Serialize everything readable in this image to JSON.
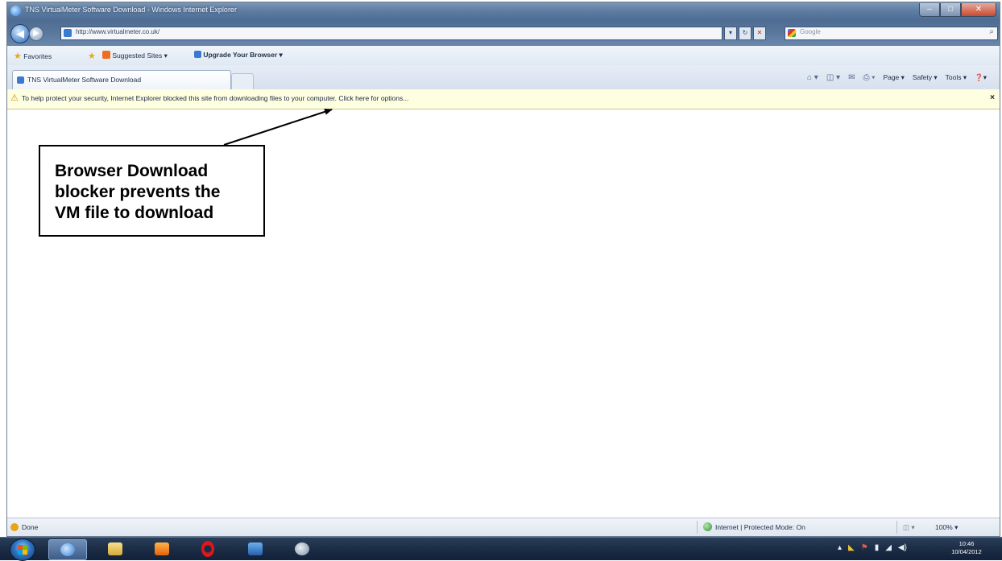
{
  "window": {
    "title": "TNS VirtualMeter Software Download - Windows Internet Explorer",
    "minimize_label": "–",
    "maximize_label": "□",
    "close_label": "✕"
  },
  "address_bar": {
    "url": "http://www.virtualmeter.co.uk/",
    "search_placeholder": "Google",
    "search_icon": "⌕"
  },
  "favorites_bar": {
    "favorites_label": "Favorites",
    "suggested_sites_label": "Suggested Sites ▾",
    "upgrade_label": "Upgrade Your Browser ▾"
  },
  "tab": {
    "label": "TNS VirtualMeter Software Download"
  },
  "command_bar": {
    "page_label": "Page ▾",
    "safety_label": "Safety ▾",
    "tools_label": "Tools ▾",
    "help_label": "❓▾"
  },
  "info_bar": {
    "message": "To help protect your security, Internet Explorer blocked this site from downloading files to your computer. Click here for options...",
    "close_label": "×"
  },
  "status_bar": {
    "status": "Done",
    "zone": "Internet | Protected Mode: On",
    "zoom": "100% ▾"
  },
  "clock": {
    "time": "10:46",
    "date": "10/04/2012"
  },
  "annotation": {
    "text": "Browser Download\nblocker prevents the\nVM file to download"
  },
  "taskbar_items": [
    "internet-explorer",
    "windows-explorer",
    "media-player",
    "opera",
    "remote-desktop",
    "paint"
  ]
}
